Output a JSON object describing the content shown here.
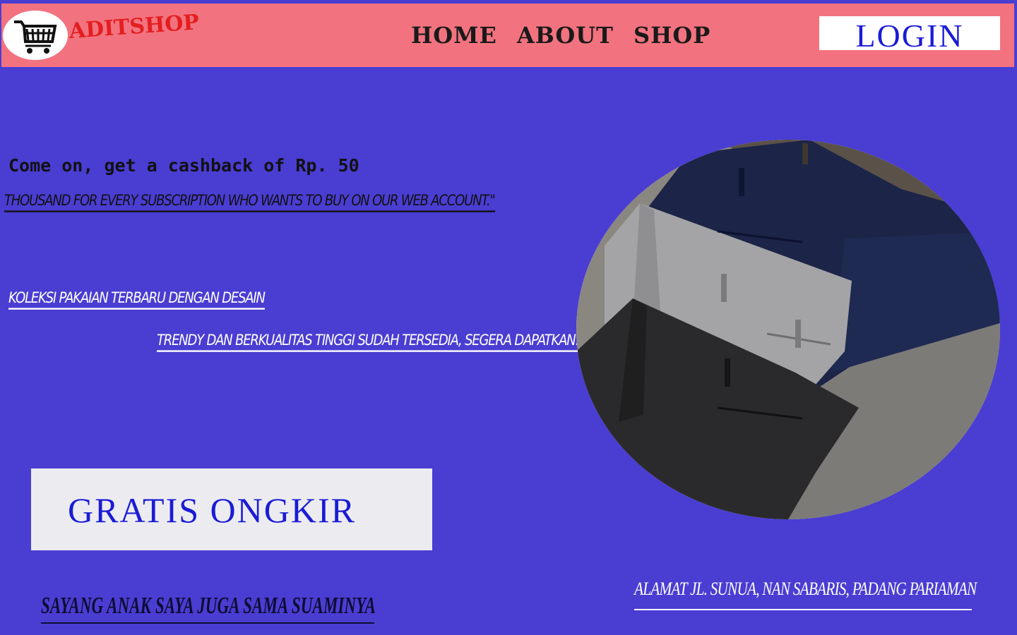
{
  "nav": {
    "brand": "ADITSHOP",
    "links": [
      "HOME",
      "ABOUT",
      "SHOP"
    ],
    "login_label": "LOGIN",
    "logo_icon": "shopping-cart-icon"
  },
  "promo": {
    "title": "Come on, get a cashback of Rp. 50",
    "subtitle": "THOUSAND FOR EVERY SUBSCRIPTION WHO WANTS TO BUY ON OUR WEB ACCOUNT.\""
  },
  "koleksi": {
    "line1": "KOLEKSI PAKAIAN TERBARU DENGAN DESAIN",
    "line2": "TRENDY DAN BERKUALITAS TINGGI SUDAH TERSEDIA, SEGERA DAPATKAN!\""
  },
  "cta": {
    "label": "GRATIS ONGKIR"
  },
  "footer": {
    "address": "ALAMAT  JL. SUNUA, NAN SABARIS, PADANG PARIAMAN",
    "tagline": "SAYANG ANAK SAYA JUGA SAMA SUAMINYA"
  },
  "colors": {
    "page_bg": "#4a3dd2",
    "navbar_bg": "#f2737f",
    "brand_red": "#e41e20",
    "accent_blue": "#1b1bd6"
  }
}
